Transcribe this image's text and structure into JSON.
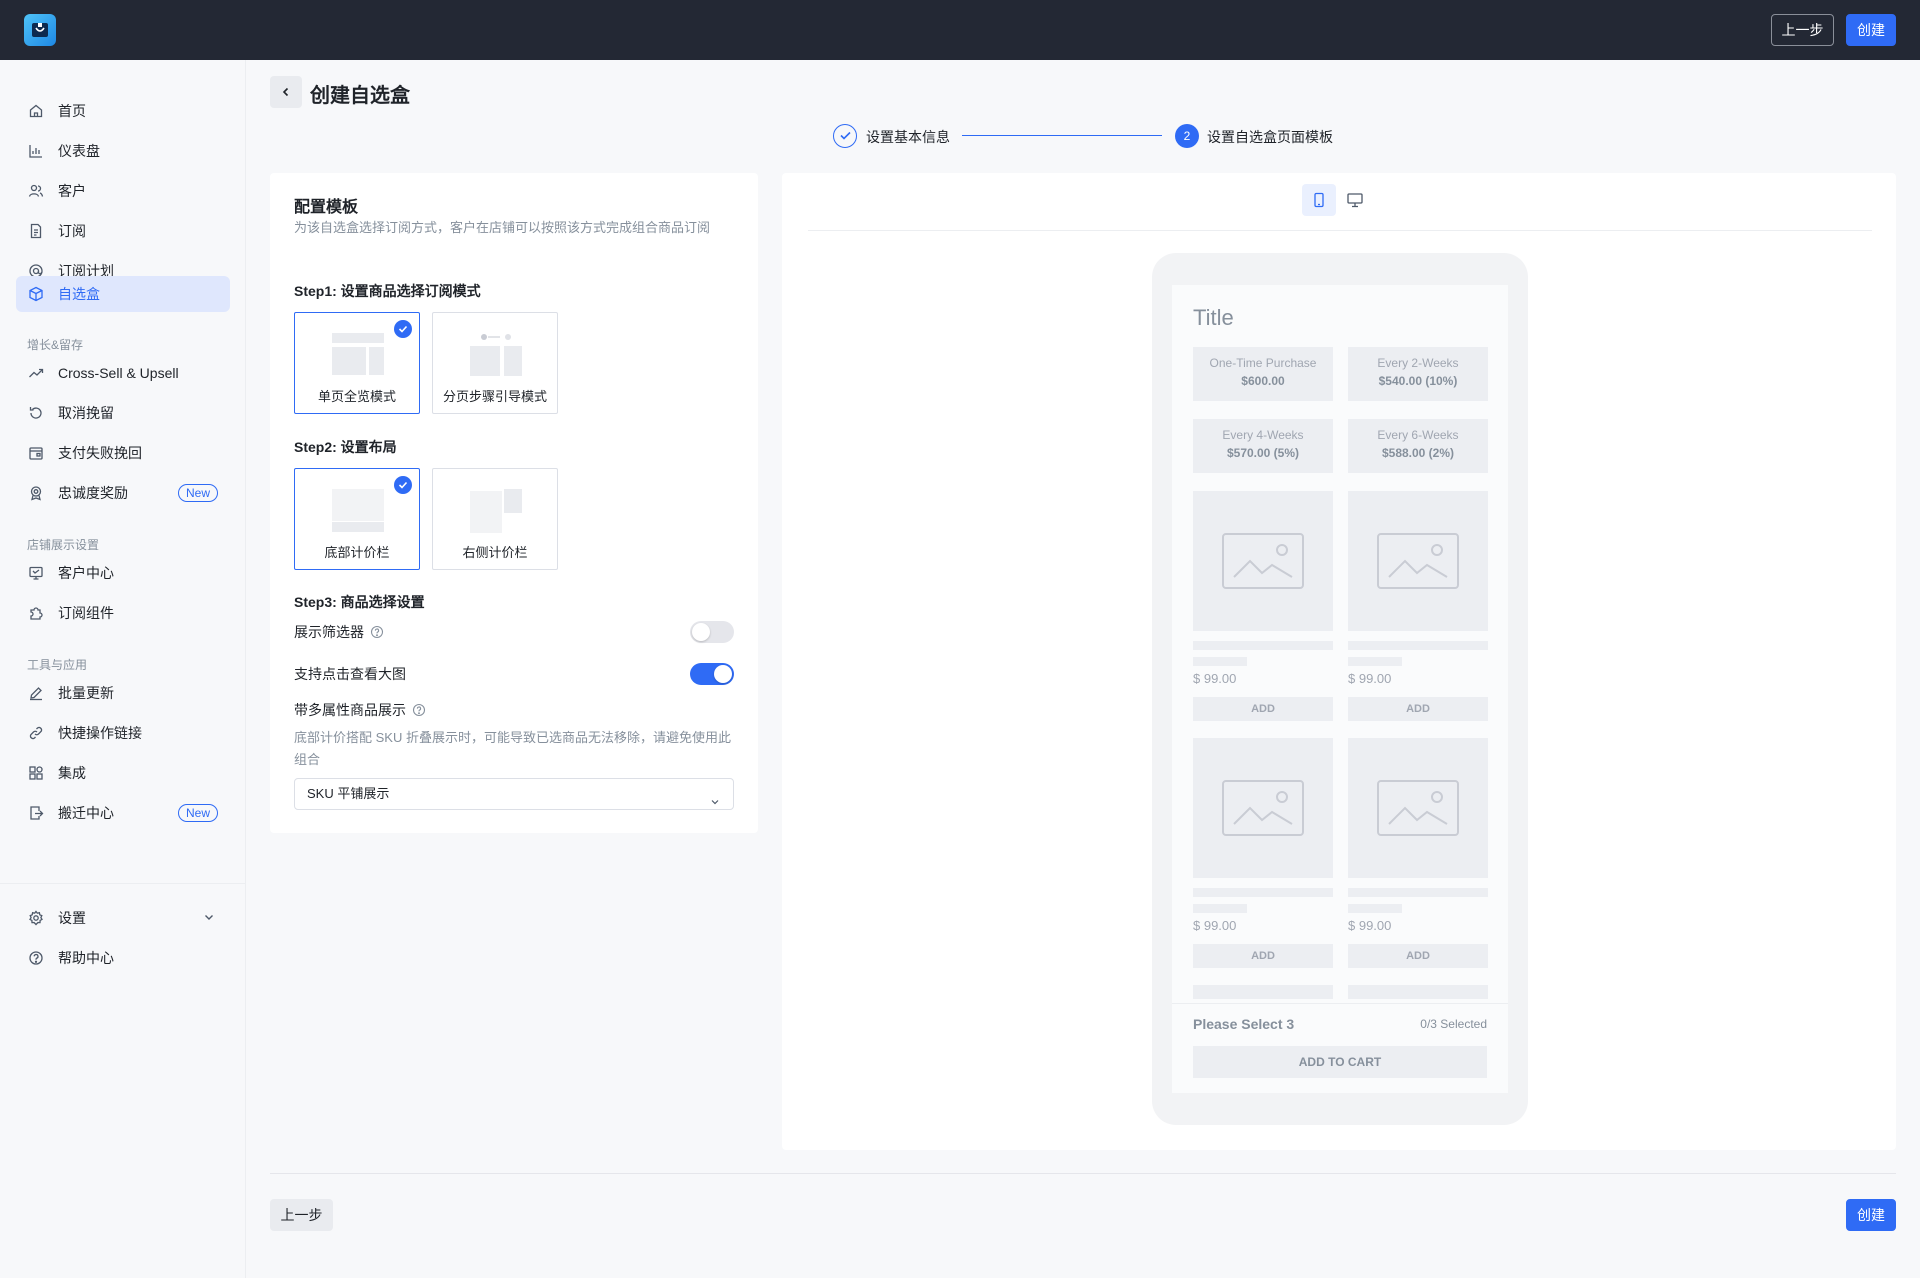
{
  "topbar": {
    "prev_label": "上一步",
    "create_label": "创建"
  },
  "sidebar": {
    "items": [
      {
        "label": "首页",
        "icon": "home-icon"
      },
      {
        "label": "仪表盘",
        "icon": "chart-icon"
      },
      {
        "label": "客户",
        "icon": "users-icon"
      },
      {
        "label": "订阅",
        "icon": "document-icon"
      },
      {
        "label": "订阅计划",
        "icon": "plan-icon"
      },
      {
        "label": "自选盒",
        "icon": "box-icon",
        "active": true
      }
    ],
    "group_growth": "增长&留存",
    "growth_items": [
      {
        "label": "Cross-Sell & Upsell",
        "icon": "trend-icon"
      },
      {
        "label": "取消挽留",
        "icon": "undo-icon"
      },
      {
        "label": "支付失败挽回",
        "icon": "wallet-icon"
      },
      {
        "label": "忠诚度奖励",
        "icon": "award-icon",
        "badge": "New"
      }
    ],
    "group_store": "店铺展示设置",
    "store_items": [
      {
        "label": "客户中心",
        "icon": "monitor-icon"
      },
      {
        "label": "订阅组件",
        "icon": "puzzle-icon"
      }
    ],
    "group_tools": "工具与应用",
    "tools_items": [
      {
        "label": "批量更新",
        "icon": "edit-icon"
      },
      {
        "label": "快捷操作链接",
        "icon": "link-icon"
      },
      {
        "label": "集成",
        "icon": "apps-icon"
      },
      {
        "label": "搬迁中心",
        "icon": "migrate-icon",
        "badge": "New"
      }
    ],
    "settings_label": "设置",
    "help_label": "帮助中心"
  },
  "page": {
    "title": "创建自选盒"
  },
  "steps": [
    {
      "label": "设置基本信息",
      "status": "done"
    },
    {
      "number": "2",
      "label": "设置自选盒页面模板",
      "status": "current"
    }
  ],
  "config": {
    "title": "配置模板",
    "description": "为该自选盒选择订阅方式，客户在店铺可以按照该方式完成组合商品订阅",
    "step1_title": "Step1: 设置商品选择订阅模式",
    "step1_options": [
      {
        "label": "单页全览模式",
        "selected": true
      },
      {
        "label": "分页步骤引导模式",
        "selected": false
      }
    ],
    "step2_title": "Step2: 设置布局",
    "step2_options": [
      {
        "label": "底部计价栏",
        "selected": true
      },
      {
        "label": "右侧计价栏",
        "selected": false
      }
    ],
    "step3_title": "Step3: 商品选择设置",
    "show_filter_label": "展示筛选器",
    "show_filter_on": false,
    "zoom_label": "支持点击查看大图",
    "zoom_on": true,
    "multi_attr_label": "带多属性商品展示",
    "multi_attr_note": "底部计价搭配 SKU 折叠展示时，可能导致已选商品无法移除，请避免使用此组合",
    "sku_select_value": "SKU 平铺展示"
  },
  "preview": {
    "title": "Title",
    "plans": [
      {
        "name": "One-Time Purchase",
        "price": "$600.00"
      },
      {
        "name": "Every 2-Weeks",
        "price": "$540.00 (10%)"
      },
      {
        "name": "Every 4-Weeks",
        "price": "$570.00 (5%)"
      },
      {
        "name": "Every 6-Weeks",
        "price": "$588.00 (2%)"
      }
    ],
    "product_price": "$ 99.00",
    "add_label": "ADD",
    "please_select": "Please Select 3",
    "selected_count": "0/3 Selected",
    "add_to_cart": "ADD TO CART"
  },
  "bottom": {
    "prev_label": "上一步",
    "create_label": "创建"
  },
  "colors": {
    "primary": "#2f6bf5",
    "topbar": "#232834"
  }
}
